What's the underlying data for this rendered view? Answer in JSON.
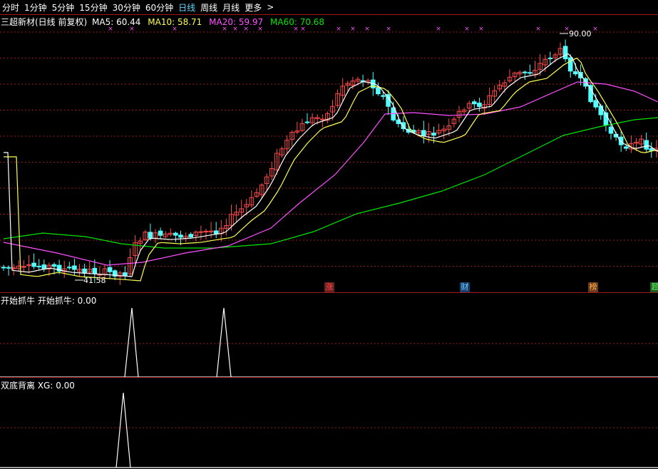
{
  "toolbar": {
    "tabs": [
      {
        "label": "分时",
        "active": false
      },
      {
        "label": "1分钟",
        "active": false
      },
      {
        "label": "5分钟",
        "active": false
      },
      {
        "label": "15分钟",
        "active": false
      },
      {
        "label": "30分钟",
        "active": false
      },
      {
        "label": "60分钟",
        "active": false
      },
      {
        "label": "日线",
        "active": true
      },
      {
        "label": "周线",
        "active": false
      },
      {
        "label": "月线",
        "active": false
      },
      {
        "label": "更多",
        "active": false
      }
    ],
    "more_arrow": ">"
  },
  "main_panel": {
    "title": "三超新材(日线 前复权)",
    "ma": [
      {
        "label": "MA5: 60.44",
        "color": "#ffffff"
      },
      {
        "label": "MA10: 58.71",
        "color": "#ffff4f"
      },
      {
        "label": "MA20: 59.97",
        "color": "#ff4fff"
      },
      {
        "label": "MA60: 70.68",
        "color": "#00e600"
      }
    ],
    "high_label": "90.00",
    "low_label": "41.58",
    "tags": [
      {
        "text": "涨",
        "color": "#ff4a4a",
        "bg": "#6b1f1f"
      },
      {
        "text": "财",
        "color": "#5fd7ff",
        "bg": "#1f3b6b"
      },
      {
        "text": "榜",
        "color": "#ffb04a",
        "bg": "#6b3b1f"
      },
      {
        "text": "题",
        "color": "#5fff5f",
        "bg": "#1f5b1f"
      }
    ],
    "marker_glyph": "×"
  },
  "panel2": {
    "label": "开始抓牛  开始抓牛: 0.00"
  },
  "panel3": {
    "label": "双底背离  XG: 0.00"
  },
  "colors": {
    "up": "#ff4a4a",
    "down": "#54ffff",
    "grid": "#9b1b1b",
    "marker": "#ff4fff",
    "ma5": "#ffffff",
    "ma10": "#ffff4f",
    "ma20": "#ff4fff",
    "ma60": "#00e600"
  }
}
